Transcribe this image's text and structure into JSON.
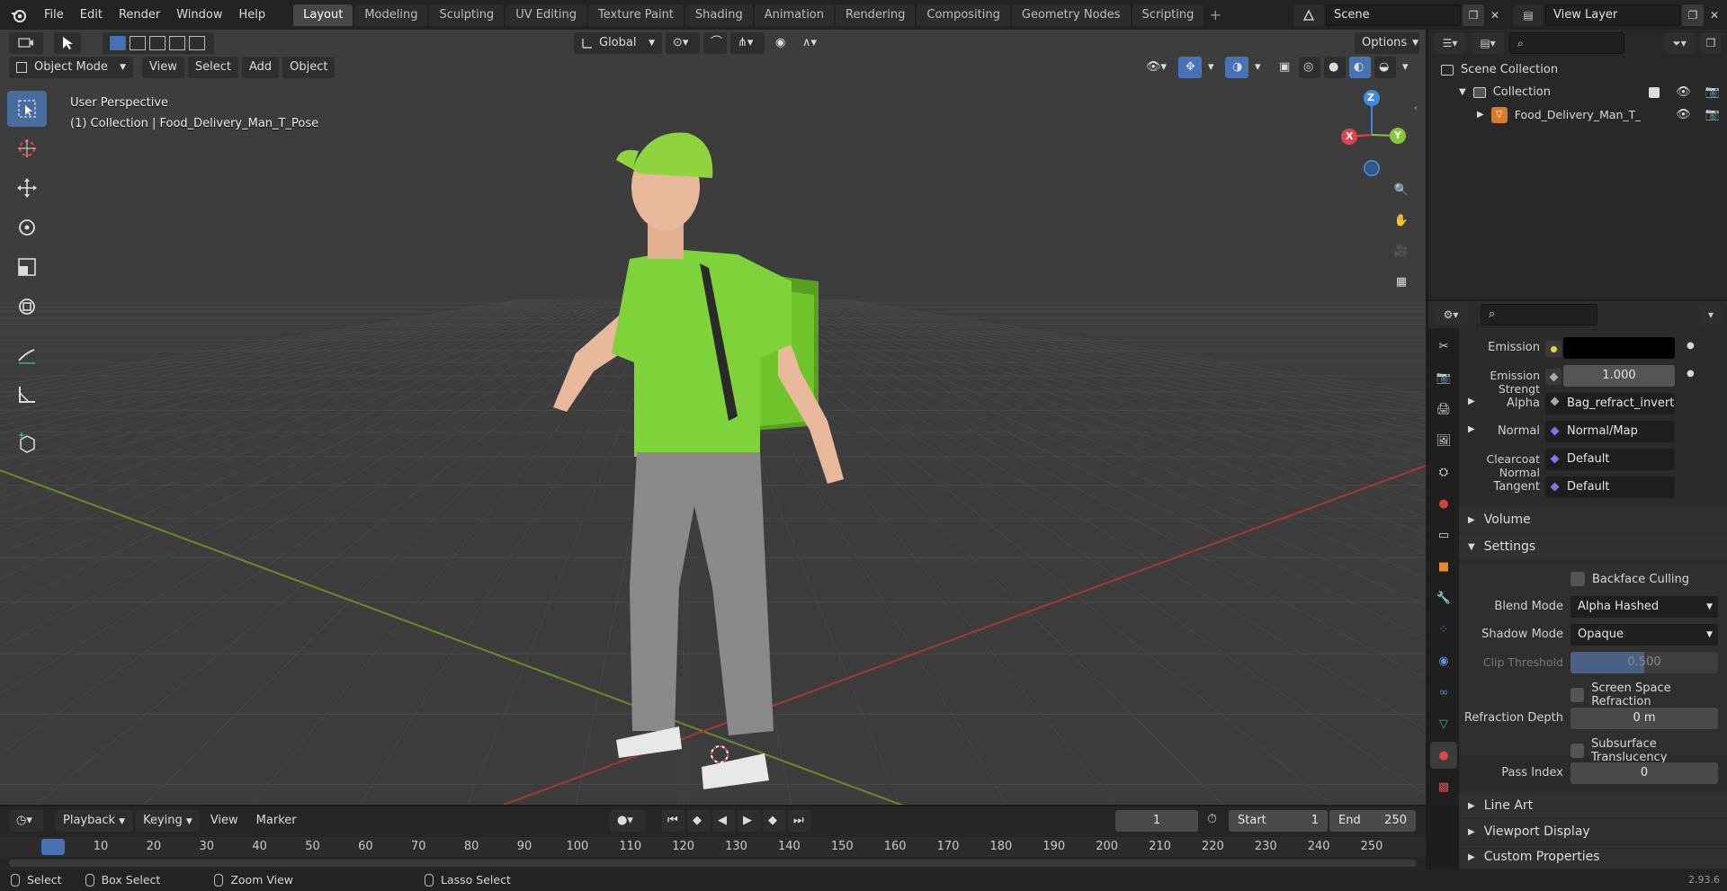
{
  "topbar": {
    "menus": [
      "File",
      "Edit",
      "Render",
      "Window",
      "Help"
    ],
    "workspaces": [
      "Layout",
      "Modeling",
      "Sculpting",
      "UV Editing",
      "Texture Paint",
      "Shading",
      "Animation",
      "Rendering",
      "Compositing",
      "Geometry Nodes",
      "Scripting"
    ],
    "active_workspace": "Layout",
    "scene": "Scene",
    "view_layer": "View Layer"
  },
  "viewport": {
    "transform_orientation": "Global",
    "options_label": "Options",
    "mode": "Object Mode",
    "menus": [
      "View",
      "Select",
      "Add",
      "Object"
    ],
    "overlay_line1": "User Perspective",
    "overlay_line2": "(1) Collection | Food_Delivery_Man_T_Pose",
    "axes": {
      "x": "X",
      "y": "Y",
      "z": "Z"
    }
  },
  "outliner": {
    "scene_collection": "Scene Collection",
    "collection": "Collection",
    "object": "Food_Delivery_Man_T_Pc"
  },
  "properties": {
    "rows": [
      {
        "label": "Emission",
        "value": "",
        "kind": "color"
      },
      {
        "label": "Emission Strengt",
        "value": "1.000",
        "kind": "number"
      },
      {
        "label": "Alpha",
        "value": "Bag_refract_invert.p...",
        "kind": "link"
      },
      {
        "label": "Normal",
        "value": "Normal/Map",
        "kind": "link"
      },
      {
        "label": "Clearcoat Normal",
        "value": "Default",
        "kind": "link"
      },
      {
        "label": "Tangent",
        "value": "Default",
        "kind": "link"
      }
    ],
    "volume": "Volume",
    "settings": "Settings",
    "backface_culling": "Backface Culling",
    "blend_mode_label": "Blend Mode",
    "blend_mode": "Alpha Hashed",
    "shadow_mode_label": "Shadow Mode",
    "shadow_mode": "Opaque",
    "clip_threshold_label": "Clip Threshold",
    "clip_threshold": "0.500",
    "screen_space_refraction": "Screen Space Refraction",
    "refraction_depth_label": "Refraction Depth",
    "refraction_depth": "0 m",
    "subsurface_translucency": "Subsurface Translucency",
    "pass_index_label": "Pass Index",
    "pass_index": "0",
    "line_art": "Line Art",
    "viewport_display": "Viewport Display",
    "custom_properties": "Custom Properties"
  },
  "timeline": {
    "menus": [
      "Playback",
      "Keying",
      "View",
      "Marker"
    ],
    "current_frame": "1",
    "start_label": "Start",
    "start": "1",
    "end_label": "End",
    "end": "250",
    "ruler": [
      "1",
      "10",
      "20",
      "30",
      "40",
      "50",
      "60",
      "70",
      "80",
      "90",
      "100",
      "110",
      "120",
      "130",
      "140",
      "150",
      "160",
      "170",
      "180",
      "190",
      "200",
      "210",
      "220",
      "230",
      "240",
      "250"
    ]
  },
  "statusbar": {
    "select": "Select",
    "box_select": "Box Select",
    "zoom_view": "Zoom View",
    "lasso_select": "Lasso Select",
    "version": "2.93.6"
  },
  "colors": {
    "accent": "#4772b3",
    "grid_x": "#a03a3a",
    "grid_y": "#6b8a2a",
    "axis_x": "#e0414f",
    "axis_y": "#8bc53f",
    "axis_z": "#3f8be0",
    "shirt": "#7fd33a"
  }
}
